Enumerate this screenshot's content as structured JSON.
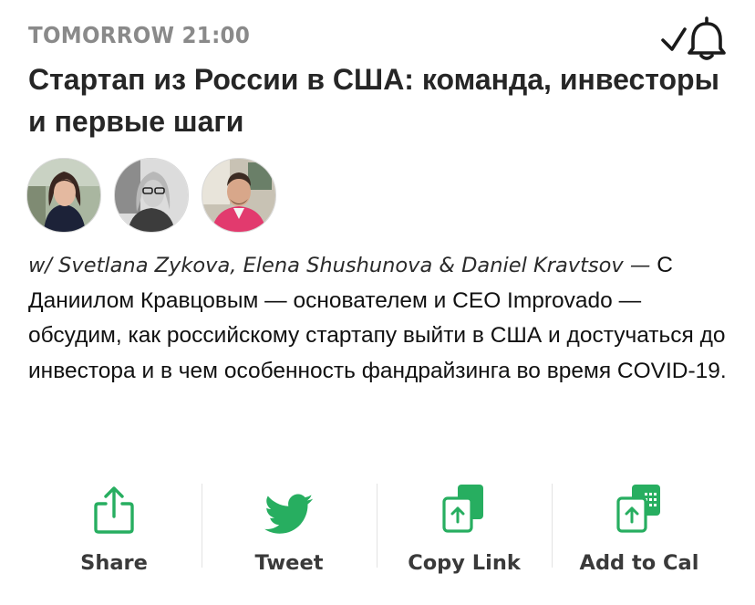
{
  "event": {
    "when": "TOMORROW 21:00",
    "title": "Стартап из России в США: команда, инвесторы и первые шаги",
    "with_line": "w/ Svetlana Zykova, Elena Shushunova & Daniel Kravtsov —",
    "description": "С Даниилом Кравцовым — основателем и CEO Improvado — обсудим, как российскому стартапу выйти в США и достучаться до инвестора и в чем особенность фандрайзинга во время COVID-19.",
    "avatars": [
      {
        "name": "Svetlana Zykova"
      },
      {
        "name": "Elena Shushunova"
      },
      {
        "name": "Daniel Kravtsov"
      }
    ]
  },
  "actions": {
    "share": "Share",
    "tweet": "Tweet",
    "copy_link": "Copy Link",
    "add_to_cal": "Add to Cal"
  },
  "colors": {
    "accent": "#27ae60",
    "muted": "#8a8a8a"
  },
  "icons": [
    "check-bell-icon",
    "share-icon",
    "twitter-bird-icon",
    "copy-link-icon",
    "calendar-add-icon"
  ]
}
